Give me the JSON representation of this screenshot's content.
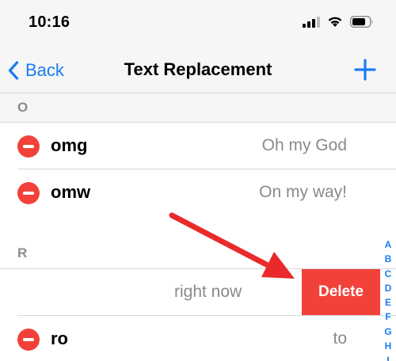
{
  "status_bar": {
    "time": "10:16"
  },
  "nav": {
    "back_label": "Back",
    "title": "Text Replacement"
  },
  "sections": {
    "o": "O",
    "r": "R"
  },
  "rows": [
    {
      "shortcut": "omg",
      "phrase": "Oh my God"
    },
    {
      "shortcut": "omw",
      "phrase": "On my way!"
    }
  ],
  "swiped_row": {
    "phrase": "right now",
    "delete_label": "Delete"
  },
  "last_row": {
    "shortcut": "ro",
    "phrase": "to"
  },
  "index_letters": [
    "A",
    "B",
    "C",
    "D",
    "E",
    "F",
    "G",
    "H",
    "I"
  ],
  "colors": {
    "accent": "#1a7cf2",
    "destructive": "#f2413a",
    "annotation_arrow": "#ea2a2a"
  }
}
